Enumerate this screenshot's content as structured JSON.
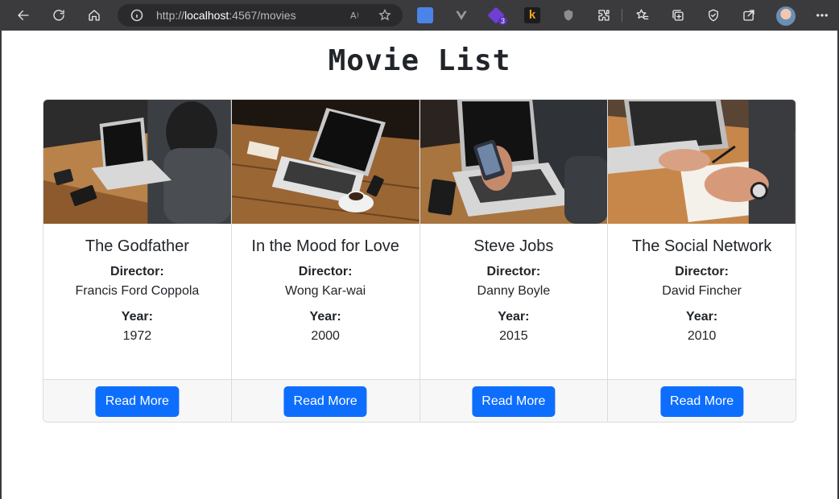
{
  "browser": {
    "url_prefix": "http://",
    "url_host": "localhost",
    "url_rest": ":4567/movies",
    "extension_badge": "3",
    "ext_k_label": "k"
  },
  "page": {
    "title": "Movie List",
    "director_label": "Director:",
    "year_label": "Year:",
    "button_label": "Read More"
  },
  "movies": [
    {
      "title": "The Godfather",
      "director": "Francis Ford Coppola",
      "year": "1972"
    },
    {
      "title": "In the Mood for Love",
      "director": "Wong Kar-wai",
      "year": "2000"
    },
    {
      "title": "Steve Jobs",
      "director": "Danny Boyle",
      "year": "2015"
    },
    {
      "title": "The Social Network",
      "director": "David Fincher",
      "year": "2010"
    }
  ],
  "colors": {
    "primary_button": "#0d6efd",
    "toolbar": "#3b3b3d",
    "footer": "#f7f7f7"
  }
}
